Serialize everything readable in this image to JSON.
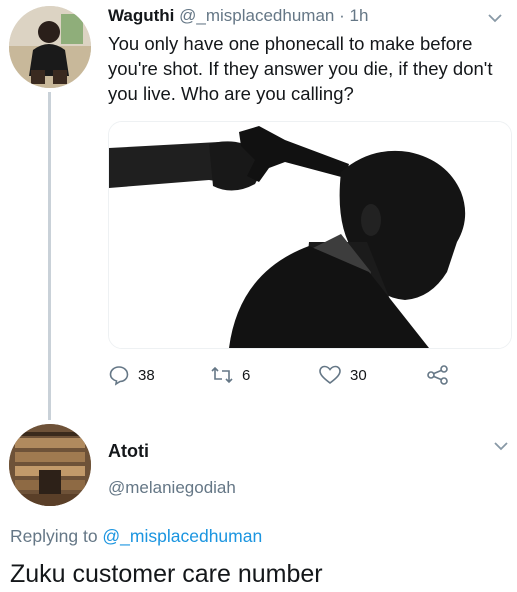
{
  "tweet": {
    "author_name": "Waguthi",
    "author_handle": "@_misplacedhuman",
    "separator": " · ",
    "time": "1h",
    "text": "You only have one phonecall to make before you're shot. If they answer you die, if they don't you live. Who are you calling?",
    "media_icon": "silhouette-gun-to-head-photo",
    "reply_count": "38",
    "retweet_count": "6",
    "like_count": "30"
  },
  "reply": {
    "author_name": "Atoti",
    "author_handle": "@melaniegodiah",
    "replying_prefix": "Replying to ",
    "replying_to": "@_misplacedhuman",
    "text": "Zuku customer care number"
  },
  "colors": {
    "secondary_text": "#657786",
    "link": "#1b95e0",
    "thread_line": "#c9d1d8"
  }
}
